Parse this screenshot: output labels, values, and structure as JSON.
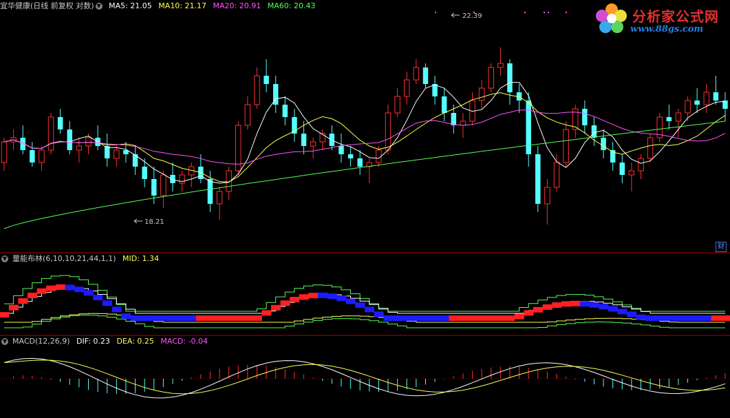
{
  "main_panel": {
    "title": "宜华健康(日线 前复权 对数)",
    "ma5": "MA5: 21.05",
    "ma10": "MA10: 21.17",
    "ma20": "MA20: 20.91",
    "ma60": "MA60: 20.43",
    "high_label": "22.39",
    "low_label": "18.21",
    "fin_button": "财"
  },
  "mid_panel": {
    "title": "量能布林(6,10,10,21,44,1,1)",
    "mid": "MID: 1.34"
  },
  "macd_panel": {
    "title": "MACD(12,26,9)",
    "dif": "DIF: 0.23",
    "dea": "DEA: 0.25",
    "macd": "MACD: -0.04"
  },
  "logo": {
    "title": "分析家公式网",
    "url": "www.88gs.com"
  },
  "colors": {
    "up": "#ff3030",
    "down": "#54ffff",
    "ma5": "#ffffff",
    "ma10": "#ffff55",
    "ma20": "#ff55ff",
    "ma60": "#55ff55",
    "boll_up": "#ff2020",
    "boll_down": "#1c1cff",
    "band_outer": "#55ff55",
    "band_inner": "#ffff55",
    "divider": "#b00000"
  },
  "chart_data": {
    "type": "candlestick",
    "ylim": [
      17.5,
      23.3
    ],
    "ohlc": [
      [
        19.6,
        20.2,
        19.4,
        20.1
      ],
      [
        20.1,
        20.4,
        19.9,
        20.2
      ],
      [
        20.2,
        20.5,
        19.8,
        19.9
      ],
      [
        19.9,
        20.1,
        19.5,
        19.6
      ],
      [
        19.6,
        20.0,
        19.4,
        19.9
      ],
      [
        19.9,
        20.8,
        19.8,
        20.7
      ],
      [
        20.7,
        20.9,
        20.3,
        20.4
      ],
      [
        20.4,
        20.6,
        19.8,
        19.9
      ],
      [
        19.9,
        20.2,
        19.6,
        20.0
      ],
      [
        20.0,
        20.3,
        19.8,
        20.2
      ],
      [
        20.2,
        20.5,
        19.9,
        20.0
      ],
      [
        20.0,
        20.3,
        19.5,
        19.7
      ],
      [
        19.7,
        20.0,
        19.5,
        19.9
      ],
      [
        19.9,
        20.1,
        19.6,
        19.8
      ],
      [
        19.8,
        20.0,
        19.3,
        19.5
      ],
      [
        19.5,
        19.7,
        19.0,
        19.2
      ],
      [
        19.2,
        19.5,
        18.6,
        18.8
      ],
      [
        18.8,
        19.4,
        18.5,
        19.3
      ],
      [
        19.3,
        19.6,
        18.9,
        19.1
      ],
      [
        19.1,
        19.4,
        18.9,
        19.3
      ],
      [
        19.3,
        19.6,
        19.0,
        19.5
      ],
      [
        19.5,
        19.8,
        19.1,
        19.2
      ],
      [
        19.2,
        19.4,
        18.4,
        18.6
      ],
      [
        18.6,
        19.0,
        18.21,
        18.9
      ],
      [
        18.9,
        19.5,
        18.7,
        19.4
      ],
      [
        19.4,
        20.6,
        19.3,
        20.5
      ],
      [
        20.5,
        21.2,
        20.4,
        21.0
      ],
      [
        21.0,
        21.9,
        20.9,
        21.7
      ],
      [
        21.7,
        22.1,
        21.3,
        21.5
      ],
      [
        21.5,
        21.7,
        20.8,
        21.0
      ],
      [
        21.0,
        21.2,
        20.5,
        20.7
      ],
      [
        20.7,
        20.9,
        20.1,
        20.3
      ],
      [
        20.3,
        20.6,
        19.8,
        20.0
      ],
      [
        20.0,
        20.2,
        19.7,
        20.1
      ],
      [
        20.1,
        20.4,
        19.9,
        20.3
      ],
      [
        20.3,
        20.5,
        19.9,
        20.0
      ],
      [
        20.0,
        20.3,
        19.6,
        19.8
      ],
      [
        19.8,
        20.0,
        19.5,
        19.7
      ],
      [
        19.7,
        19.9,
        19.3,
        19.5
      ],
      [
        19.5,
        19.7,
        19.1,
        19.6
      ],
      [
        19.6,
        20.0,
        19.5,
        19.9
      ],
      [
        19.9,
        21.0,
        19.8,
        20.8
      ],
      [
        20.8,
        21.4,
        20.7,
        21.2
      ],
      [
        21.2,
        21.8,
        21.0,
        21.6
      ],
      [
        21.6,
        22.1,
        21.5,
        21.9
      ],
      [
        21.9,
        22.0,
        21.4,
        21.5
      ],
      [
        21.5,
        21.7,
        21.0,
        21.2
      ],
      [
        21.2,
        21.4,
        20.6,
        20.8
      ],
      [
        20.8,
        21.0,
        20.3,
        20.5
      ],
      [
        20.5,
        20.8,
        20.2,
        20.6
      ],
      [
        20.6,
        21.3,
        20.5,
        21.1
      ],
      [
        21.1,
        21.6,
        20.9,
        21.4
      ],
      [
        21.4,
        22.0,
        21.3,
        21.9
      ],
      [
        21.9,
        22.39,
        21.7,
        22.0
      ],
      [
        22.0,
        22.1,
        21.0,
        21.3
      ],
      [
        21.3,
        21.5,
        20.8,
        21.1
      ],
      [
        21.1,
        21.3,
        19.5,
        19.8
      ],
      [
        19.8,
        20.0,
        18.4,
        18.6
      ],
      [
        18.6,
        19.2,
        18.1,
        19.0
      ],
      [
        19.0,
        19.8,
        18.9,
        19.6
      ],
      [
        19.6,
        20.6,
        19.5,
        20.4
      ],
      [
        20.4,
        21.0,
        20.2,
        20.9
      ],
      [
        20.9,
        21.1,
        20.3,
        20.5
      ],
      [
        20.5,
        20.7,
        20.0,
        20.2
      ],
      [
        20.2,
        20.4,
        19.7,
        19.9
      ],
      [
        19.9,
        20.1,
        19.4,
        19.6
      ],
      [
        19.6,
        19.8,
        19.1,
        19.3
      ],
      [
        19.3,
        19.6,
        18.9,
        19.4
      ],
      [
        19.4,
        19.8,
        19.2,
        19.7
      ],
      [
        19.7,
        20.3,
        19.6,
        20.2
      ],
      [
        20.2,
        20.8,
        20.1,
        20.7
      ],
      [
        20.7,
        21.0,
        20.4,
        20.6
      ],
      [
        20.6,
        20.9,
        20.2,
        20.8
      ],
      [
        20.8,
        21.2,
        20.6,
        21.1
      ],
      [
        21.1,
        21.4,
        20.8,
        21.0
      ],
      [
        21.0,
        21.5,
        20.8,
        21.3
      ],
      [
        21.3,
        21.7,
        21.0,
        21.1
      ],
      [
        21.1,
        21.3,
        20.6,
        20.9
      ]
    ]
  }
}
